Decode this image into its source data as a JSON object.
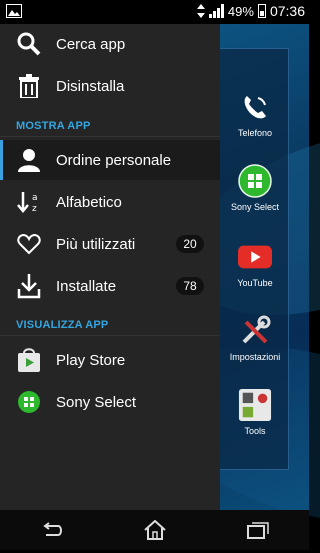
{
  "status_bar": {
    "battery": "49%",
    "time": "07:36"
  },
  "drawer": {
    "top_items": [
      {
        "label": "Cerca app",
        "icon": "search-icon"
      },
      {
        "label": "Disinstalla",
        "icon": "trash-icon"
      }
    ],
    "sections": [
      {
        "header": "MOSTRA APP",
        "items": [
          {
            "label": "Ordine personale",
            "icon": "person-icon",
            "selected": true
          },
          {
            "label": "Alfabetico",
            "icon": "sort-alpha-icon"
          },
          {
            "label": "Più utilizzati",
            "icon": "heart-icon",
            "badge": "20"
          },
          {
            "label": "Installate",
            "icon": "download-icon",
            "badge": "78"
          }
        ]
      },
      {
        "header": "VISUALIZZA APP",
        "items": [
          {
            "label": "Play Store",
            "icon": "play-store-icon"
          },
          {
            "label": "Sony Select",
            "icon": "sony-select-icon"
          }
        ]
      }
    ]
  },
  "home_apps": [
    {
      "label": "Telefono",
      "icon": "phone-icon"
    },
    {
      "label": "Sony Select",
      "icon": "sony-select-icon"
    },
    {
      "label": "YouTube",
      "icon": "youtube-icon"
    },
    {
      "label": "Impostazioni",
      "icon": "settings-tools-icon"
    },
    {
      "label": "Tools",
      "icon": "tools-folder-icon"
    }
  ],
  "nav_bar": {
    "back": "back-icon",
    "home": "home-icon",
    "recents": "recents-icon"
  },
  "colors": {
    "drawer_bg": "#252525",
    "section_header": "#33a6e0",
    "selected_indicator": "#3aa0e0",
    "sony_green": "#2eb82e",
    "youtube_red": "#e52d27"
  }
}
